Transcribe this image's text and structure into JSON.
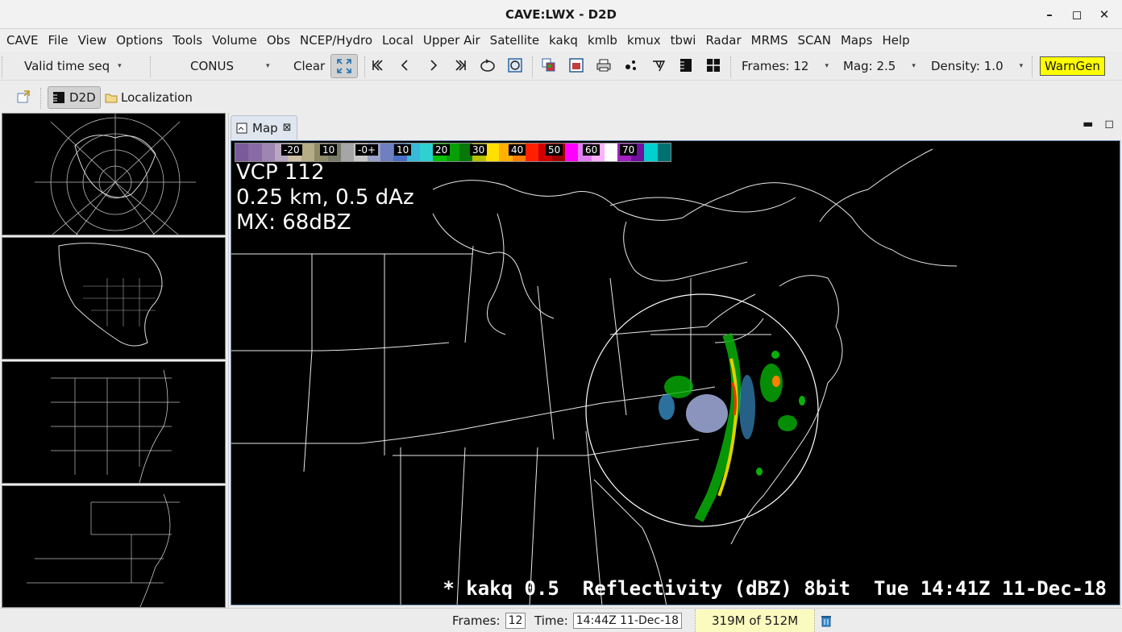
{
  "window": {
    "title": "CAVE:LWX - D2D"
  },
  "menubar": [
    "CAVE",
    "File",
    "View",
    "Options",
    "Tools",
    "Volume",
    "Obs",
    "NCEP/Hydro",
    "Local",
    "Upper Air",
    "Satellite",
    "kakq",
    "kmlb",
    "kmux",
    "tbwi",
    "Radar",
    "MRMS",
    "SCAN",
    "Maps",
    "Help"
  ],
  "toolbar": {
    "time_mode": "Valid time seq",
    "scale": "CONUS",
    "clear_label": "Clear",
    "frames_label": "Frames: 12",
    "mag_label": "Mag: 2.5",
    "density_label": "Density: 1.0",
    "warngen_label": "WarnGen"
  },
  "perspectives": {
    "d2d_label": "D2D",
    "localization_label": "Localization"
  },
  "map_tab": {
    "label": "Map"
  },
  "colorbar": {
    "labels": [
      "-20",
      "10",
      "-0+",
      "10",
      "20",
      "30",
      "40",
      "50",
      "60",
      "70"
    ],
    "colors": [
      "#7a5a9a",
      "#8a6aa5",
      "#9f85b2",
      "#b9a6c0",
      "#cdbfa7",
      "#b6ac85",
      "#8f8a68",
      "#7a7a6a",
      "#a6a6a6",
      "#c8c8c8",
      "#9aa0c6",
      "#6f7fc0",
      "#4b6fc4",
      "#38b9d8",
      "#2fd0d0",
      "#08c008",
      "#06a006",
      "#087808",
      "#b8c000",
      "#ffe000",
      "#ffb000",
      "#ff8000",
      "#ff2000",
      "#d00000",
      "#a00000",
      "#ff00ff",
      "#e080f0",
      "#ffb0ff",
      "#ffffff",
      "#a020c0",
      "#7010a0",
      "#00d0d0",
      "#007070"
    ]
  },
  "radar_info": {
    "vcp": "VCP 112",
    "elevation": "0.25 km, 0.5 dAz",
    "max": "MX: 68dBZ"
  },
  "legend": {
    "text": "* kakq 0.5  Reflectivity (dBZ) 8bit  Tue 14:41Z 11-Dec-18"
  },
  "statusbar": {
    "frames_label": "Frames:",
    "frames_value": "12",
    "time_label": "Time:",
    "time_value": "14:44Z 11-Dec-18",
    "memory": "319M of 512M"
  }
}
